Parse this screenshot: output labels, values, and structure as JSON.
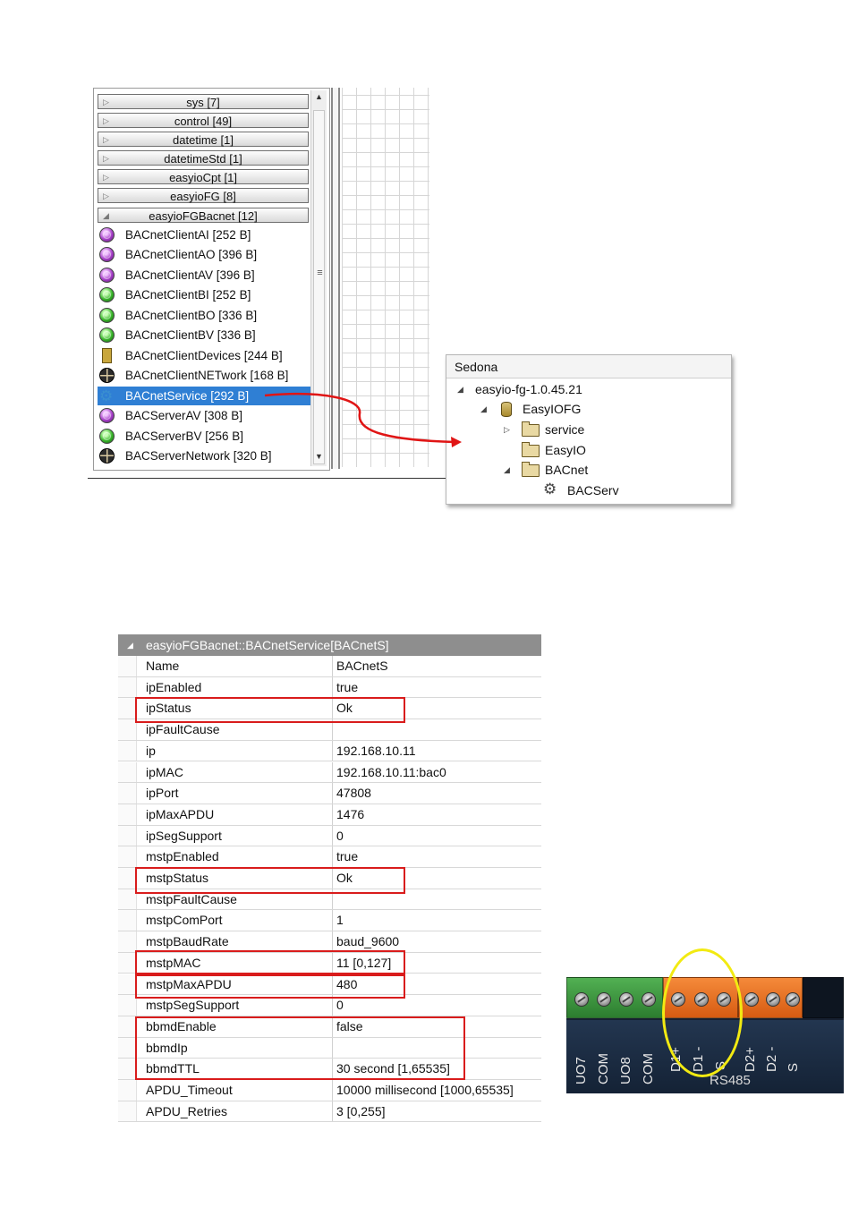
{
  "palette": {
    "categories": [
      {
        "label": "sys [7]",
        "expanded": false
      },
      {
        "label": "control [49]",
        "expanded": false
      },
      {
        "label": "datetime [1]",
        "expanded": false
      },
      {
        "label": "datetimeStd [1]",
        "expanded": false
      },
      {
        "label": "easyioCpt [1]",
        "expanded": false
      },
      {
        "label": "easyioFG [8]",
        "expanded": false
      },
      {
        "label": "easyioFGBacnet [12]",
        "expanded": true
      }
    ],
    "components": [
      {
        "label": "BACnetClientAI [252 B]",
        "icon": "purple-ball-icon"
      },
      {
        "label": "BACnetClientAO [396 B]",
        "icon": "purple-ball-icon"
      },
      {
        "label": "BACnetClientAV [396 B]",
        "icon": "purple-ball-icon"
      },
      {
        "label": "BACnetClientBI [252 B]",
        "icon": "green-ball-icon"
      },
      {
        "label": "BACnetClientBO [336 B]",
        "icon": "green-ball-icon"
      },
      {
        "label": "BACnetClientBV [336 B]",
        "icon": "green-ball-icon"
      },
      {
        "label": "BACnetClientDevices [244 B]",
        "icon": "device-icon"
      },
      {
        "label": "BACnetClientNETwork [168 B]",
        "icon": "globe-icon"
      },
      {
        "label": "BACnetService [292 B]",
        "icon": "gears-icon",
        "selected": true
      },
      {
        "label": "BACServerAV [308 B]",
        "icon": "purple-ball-icon"
      },
      {
        "label": "BACServerBV [256 B]",
        "icon": "green-ball-icon"
      },
      {
        "label": "BACServerNetwork [320 B]",
        "icon": "globe-icon"
      }
    ]
  },
  "sedona": {
    "title": "Sedona",
    "nodes": [
      {
        "label": "easyio-fg-1.0.45.21",
        "icon": "expanded-triangle-icon"
      },
      {
        "label": "EasyIOFG",
        "icon": "database-icon"
      },
      {
        "label": "service",
        "icon": "folder-icon"
      },
      {
        "label": "EasyIO",
        "icon": "folder-icon"
      },
      {
        "label": "BACnet",
        "icon": "folder-icon"
      },
      {
        "label": "BACServ",
        "icon": "gears-icon"
      }
    ]
  },
  "properties": {
    "header": "easyioFGBacnet::BACnetService[BACnetS]",
    "rows": [
      {
        "name": "Name",
        "value": "BACnetS"
      },
      {
        "name": "ipEnabled",
        "value": "true"
      },
      {
        "name": "ipStatus",
        "value": "Ok"
      },
      {
        "name": "ipFaultCause",
        "value": ""
      },
      {
        "name": "ip",
        "value": "192.168.10.11"
      },
      {
        "name": "ipMAC",
        "value": "192.168.10.11:bac0"
      },
      {
        "name": "ipPort",
        "value": "47808"
      },
      {
        "name": "ipMaxAPDU",
        "value": "1476"
      },
      {
        "name": "ipSegSupport",
        "value": "0"
      },
      {
        "name": "mstpEnabled",
        "value": "true"
      },
      {
        "name": "mstpStatus",
        "value": "Ok"
      },
      {
        "name": "mstpFaultCause",
        "value": ""
      },
      {
        "name": "mstpComPort",
        "value": "1"
      },
      {
        "name": "mstpBaudRate",
        "value": "baud_9600"
      },
      {
        "name": "mstpMAC",
        "value": "11 [0,127]"
      },
      {
        "name": "mstpMaxAPDU",
        "value": "480"
      },
      {
        "name": "mstpSegSupport",
        "value": "0"
      },
      {
        "name": "bbmdEnable",
        "value": "false"
      },
      {
        "name": "bbmdIp",
        "value": ""
      },
      {
        "name": "bbmdTTL",
        "value": "30 second [1,65535]"
      },
      {
        "name": "APDU_Timeout",
        "value": "10000 millisecond [1000,65535]"
      },
      {
        "name": "APDU_Retries",
        "value": "3 [0,255]"
      }
    ]
  },
  "terminal_photo": {
    "port_labels": [
      "UO7",
      "COM",
      "UO8",
      "COM",
      "D1+",
      "D1 -",
      "S",
      "D2+",
      "D2 -",
      "S"
    ],
    "bus_label": "RS485"
  },
  "colors": {
    "highlight_red": "#d91c1c",
    "selection_blue": "#2f7fd4",
    "circle_yellow": "#f2ea12"
  }
}
